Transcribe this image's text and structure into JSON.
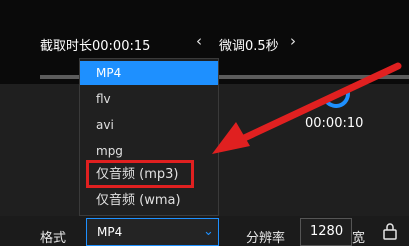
{
  "header": {
    "capture_duration": "截取时长00:00:15",
    "nudge_label": "微调0.5秒",
    "prev_glyph": "‹",
    "next_glyph": "›"
  },
  "preview": {
    "time": "00:00:10"
  },
  "format_dropdown": {
    "options": [
      "MP4",
      "flv",
      "avi",
      "mpg",
      "仅音频 (mp3)",
      "仅音频 (wma)"
    ],
    "selected": "MP4",
    "highlighted_option": "仅音频 (mp3)"
  },
  "bottom": {
    "format_label": "格式",
    "format_value": "MP4",
    "chevron_glyph": "⌄",
    "resolution_label": "分辨率",
    "width_value": "1280",
    "width_unit": "宽"
  },
  "colors": {
    "accent": "#1e90ff",
    "annotation_red": "#e02020"
  },
  "icons": {
    "lock": "lock-icon",
    "chevron": "chevron-down-icon",
    "prev": "chevron-left-icon",
    "next": "chevron-right-icon"
  }
}
